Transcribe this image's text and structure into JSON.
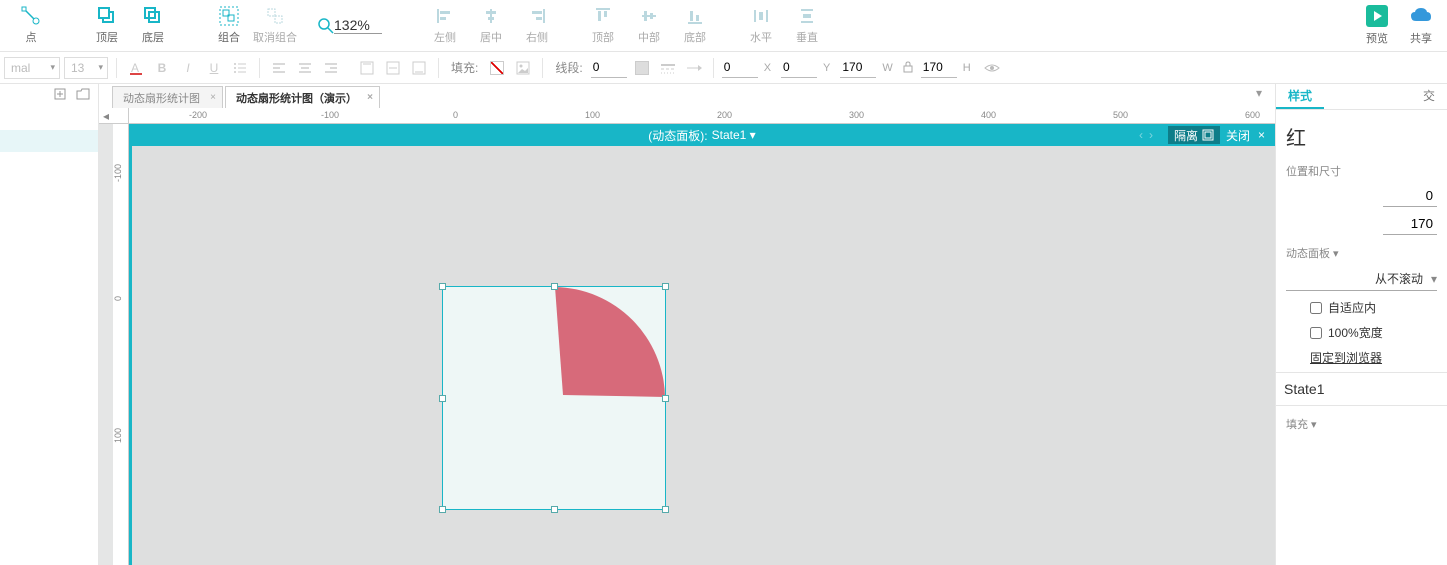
{
  "toolbar": {
    "point": "点",
    "front": "顶层",
    "back": "底层",
    "group": "组合",
    "ungroup": "取消组合",
    "zoom_value": "132%",
    "align_left": "左侧",
    "align_center": "居中",
    "align_right": "右侧",
    "align_top": "顶部",
    "align_middle": "中部",
    "align_bottom": "底部",
    "dist_h": "水平",
    "dist_v": "垂直",
    "preview": "预览",
    "share": "共享"
  },
  "formatbar": {
    "font_family": "mal",
    "font_size": "13",
    "fill_label": "填充:",
    "stroke_label": "线段:",
    "stroke_width": "0",
    "x": "0",
    "x_label": "X",
    "y": "0",
    "y_label": "Y",
    "w": "170",
    "w_label": "W",
    "h": "170",
    "h_label": "H"
  },
  "tabs": {
    "t1": "动态扇形统计图",
    "t2": "动态扇形统计图（演示）"
  },
  "canvas_bar": {
    "title_prefix": "(动态面板):",
    "state": "State1",
    "isolate": "隔离",
    "close": "关闭"
  },
  "ruler_h": [
    "-200",
    "-100",
    "0",
    "100",
    "200",
    "300",
    "400",
    "500",
    "600"
  ],
  "ruler_v": [
    "-100",
    "0",
    "100"
  ],
  "inspector": {
    "tab_style": "样式",
    "tab_interact": "交",
    "name": "红",
    "sec_pos": "位置和尺寸",
    "val_x": "0",
    "val_w": "170",
    "sec_dp": "动态面板",
    "scroll_mode": "从不滚动",
    "fit_content": "自适应内",
    "full_width": "100%宽度",
    "pin_browser": "固定到浏览器",
    "state_name": "State1",
    "sec_fill": "填充"
  }
}
